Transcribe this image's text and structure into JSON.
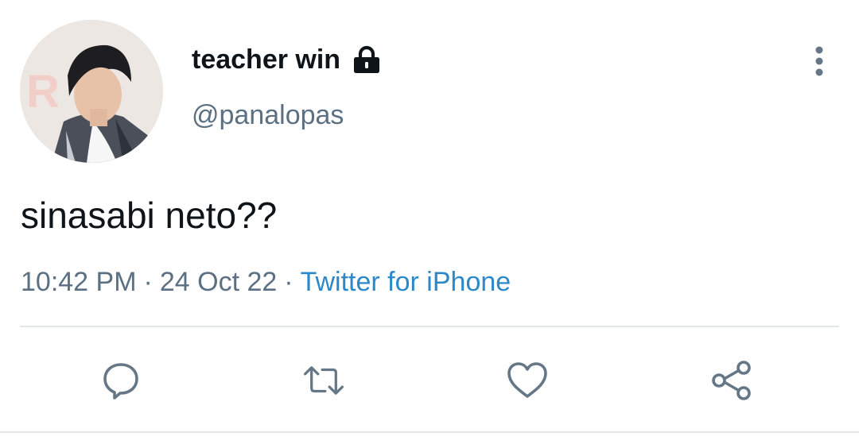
{
  "tweet": {
    "display_name": "teacher win",
    "handle": "@panalopas",
    "text": "sinasabi neto??",
    "time": "10:42 PM",
    "date": "24 Oct 22",
    "separator": "·",
    "source": "Twitter for iPhone",
    "protected": true
  },
  "icons": {
    "avatar": "profile-photo",
    "lock": "lock-icon",
    "more": "more-vertical-icon",
    "reply": "reply-icon",
    "retweet": "retweet-icon",
    "like": "heart-icon",
    "share": "share-icon"
  },
  "colors": {
    "text_primary": "#0f1419",
    "text_secondary": "#5b7083",
    "link": "#2b88c9",
    "icon_gray": "#657786",
    "divider": "#e3e6e8"
  }
}
